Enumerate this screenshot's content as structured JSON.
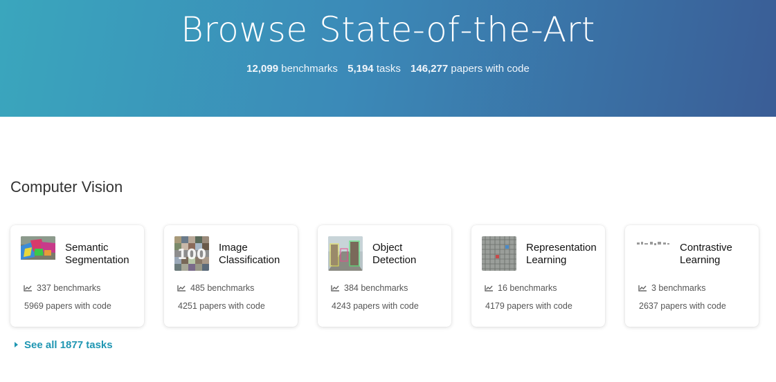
{
  "hero": {
    "title": "Browse State-of-the-Art",
    "stats": [
      {
        "value": "12,099",
        "label": "benchmarks"
      },
      {
        "value": "5,194",
        "label": "tasks"
      },
      {
        "value": "146,277",
        "label": "papers with code"
      }
    ]
  },
  "section": {
    "title": "Computer Vision",
    "cards": [
      {
        "title": "Semantic Segmentation",
        "benchmarks": "337 benchmarks",
        "papers": "5969 papers with code",
        "thumb_icon": "segmentation-thumbnail"
      },
      {
        "title": "Image Classification",
        "benchmarks": "485 benchmarks",
        "papers": "4251 papers with code",
        "thumb_icon": "classification-thumbnail"
      },
      {
        "title": "Object Detection",
        "benchmarks": "384 benchmarks",
        "papers": "4243 papers with code",
        "thumb_icon": "detection-thumbnail"
      },
      {
        "title": "Representation Learning",
        "benchmarks": "16 benchmarks",
        "papers": "4179 papers with code",
        "thumb_icon": "representation-thumbnail"
      },
      {
        "title": "Contrastive Learning",
        "benchmarks": "3 benchmarks",
        "papers": "2637 papers with code",
        "thumb_icon": "contrastive-thumbnail"
      }
    ],
    "see_all": "See all 1877 tasks"
  },
  "colors": {
    "hero_gradient_start": "#3aa6bd",
    "hero_gradient_end": "#3a5d96",
    "link": "#1f96b2"
  }
}
